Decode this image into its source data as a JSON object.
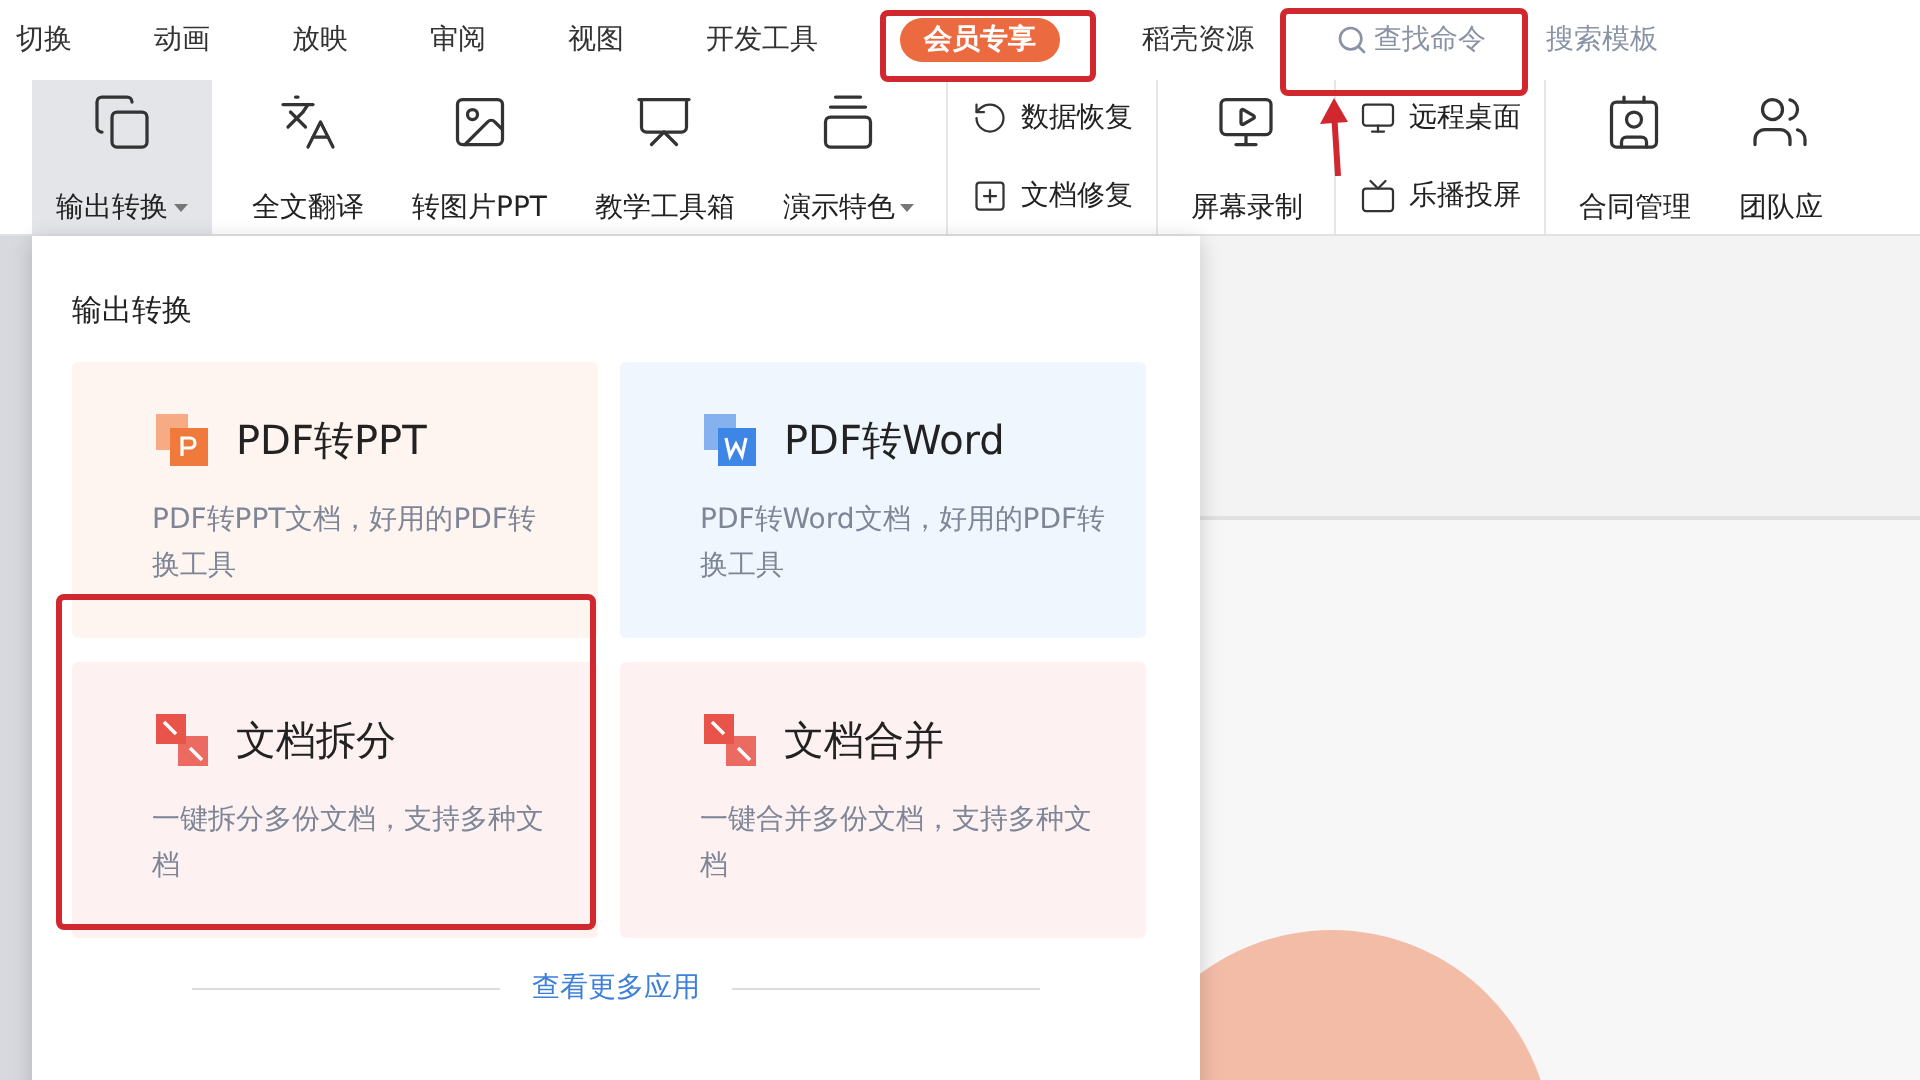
{
  "tabs": [
    {
      "label": "切换",
      "selected": false
    },
    {
      "label": "动画",
      "selected": false
    },
    {
      "label": "放映",
      "selected": false
    },
    {
      "label": "审阅",
      "selected": false
    },
    {
      "label": "视图",
      "selected": false
    },
    {
      "label": "开发工具",
      "selected": false
    },
    {
      "label": "会员专享",
      "selected": true
    },
    {
      "label": "稻壳资源",
      "selected": false
    }
  ],
  "search": {
    "placeholder": "查找命令"
  },
  "template_link": "搜索模板",
  "ribbon": [
    {
      "kind": "big",
      "label": "输出转换",
      "caret": true,
      "selected": true
    },
    {
      "kind": "big",
      "label": "全文翻译",
      "caret": false,
      "selected": false
    },
    {
      "kind": "big",
      "label": "转图片PPT",
      "caret": false,
      "selected": false
    },
    {
      "kind": "big",
      "label": "教学工具箱",
      "caret": false,
      "selected": false
    },
    {
      "kind": "big",
      "label": "演示特色",
      "caret": true,
      "selected": false
    },
    {
      "kind": "pair",
      "items": [
        "数据恢复",
        "文档修复"
      ]
    },
    {
      "kind": "big",
      "label": "屏幕录制",
      "caret": false,
      "selected": false
    },
    {
      "kind": "pair",
      "items": [
        "远程桌面",
        "乐播投屏"
      ]
    },
    {
      "kind": "big",
      "label": "合同管理",
      "caret": false,
      "selected": false
    },
    {
      "kind": "big",
      "label": "团队应",
      "caret": false,
      "selected": false
    }
  ],
  "menu": {
    "title": "输出转换",
    "cards": [
      {
        "kind": "ppt",
        "title": "PDF转PPT",
        "description": "PDF转PPT文档，好用的PDF转换工具",
        "color": "#f07a3c"
      },
      {
        "kind": "word",
        "title": "PDF转Word",
        "description": "PDF转Word文档，好用的PDF转换工具",
        "color": "#3d86e6"
      },
      {
        "kind": "split",
        "title": "文档拆分",
        "description": "一键拆分多份文档，支持多种文档",
        "color": "#e8534a"
      },
      {
        "kind": "merge",
        "title": "文档合并",
        "description": "一键合并多份文档，支持多种文档",
        "color": "#e8534a"
      }
    ],
    "more_link": "查看更多应用"
  }
}
